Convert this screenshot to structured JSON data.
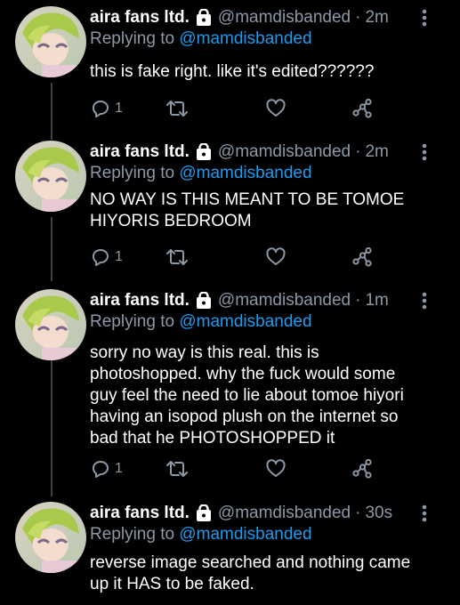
{
  "colors": {
    "background": "#000000",
    "secondary_text": "#8b98a5",
    "link": "#1d9bf0",
    "thread_line": "#3d4145"
  },
  "icons": {
    "protected": "lock-icon",
    "more": "more-vertical-icon",
    "reply": "reply-icon",
    "retweet": "retweet-icon",
    "like": "heart-icon",
    "share": "share-icon"
  },
  "tweets": [
    {
      "name": "aira fans ltd.",
      "handle": "@mamdisbanded",
      "separator": "·",
      "time": "2m",
      "replying_prefix": "Replying to",
      "replying_to": "@mamdisbanded",
      "text": "this is fake right. like it's edited??????",
      "reply_count": "1"
    },
    {
      "name": "aira fans ltd.",
      "handle": "@mamdisbanded",
      "separator": "·",
      "time": "2m",
      "replying_prefix": "Replying to",
      "replying_to": "@mamdisbanded",
      "text": "NO WAY IS THIS MEANT TO BE TOMOE\nHIYORIS BEDROOM",
      "reply_count": "1"
    },
    {
      "name": "aira fans ltd.",
      "handle": "@mamdisbanded",
      "separator": "·",
      "time": "1m",
      "replying_prefix": "Replying to",
      "replying_to": "@mamdisbanded",
      "text": "sorry no way is this real. this is\nphotoshopped. why the fuck would some\nguy feel the need to lie about tomoe hiyori\nhaving an isopod plush on the internet so\nbad that he PHOTOSHOPPED it",
      "reply_count": "1"
    },
    {
      "name": "aira fans ltd.",
      "handle": "@mamdisbanded",
      "separator": "·",
      "time": "30s",
      "replying_prefix": "Replying to",
      "replying_to": "@mamdisbanded",
      "text": "reverse image searched and nothing came\nup it HAS to be faked."
    }
  ]
}
